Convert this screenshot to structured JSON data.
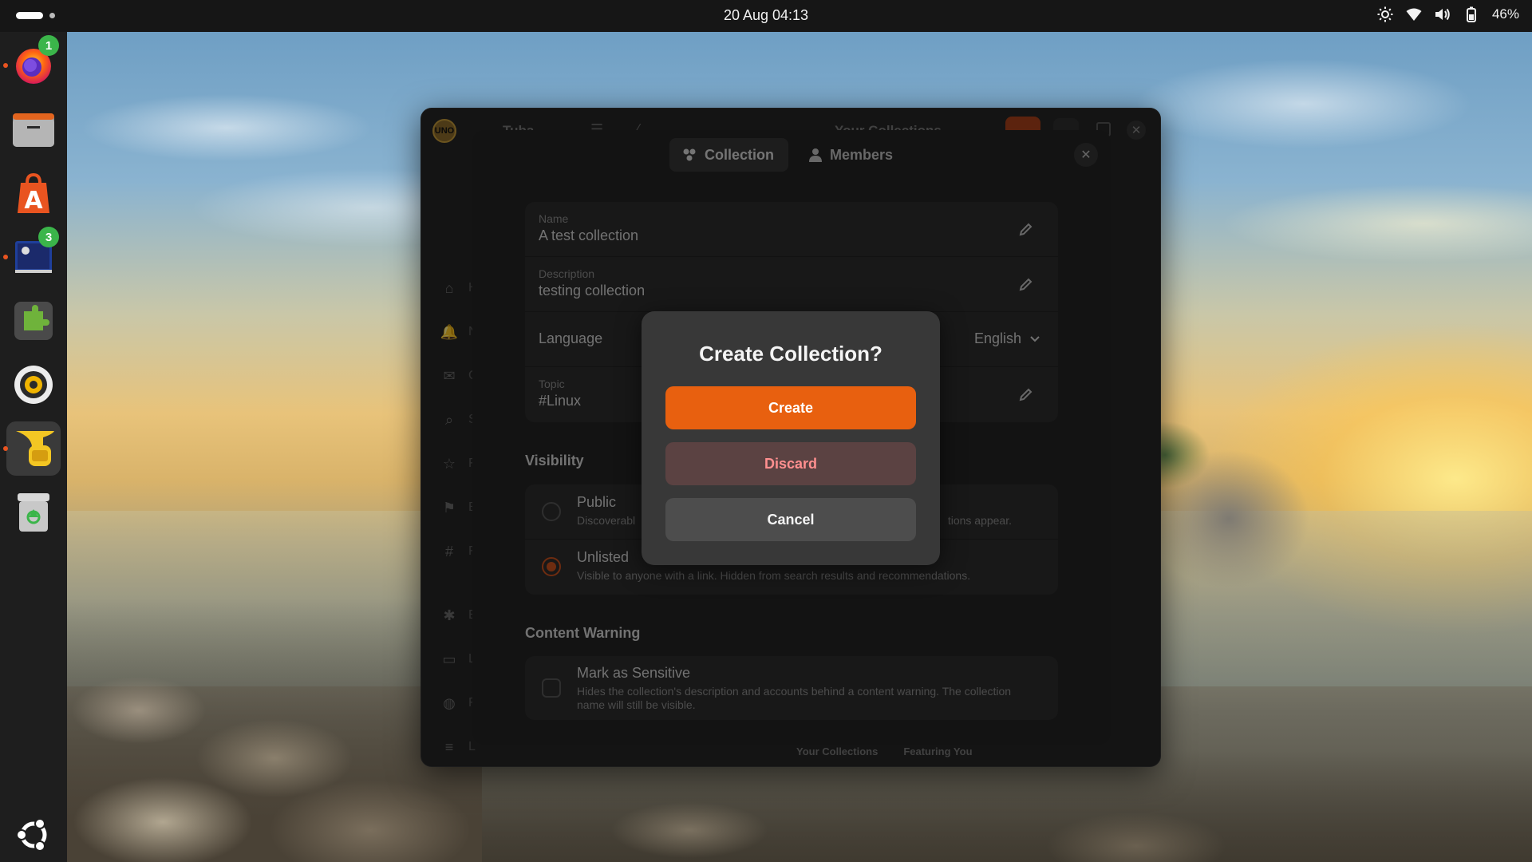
{
  "topbar": {
    "clock": "20 Aug  04:13",
    "battery": "46%",
    "icons": [
      "brightness-icon",
      "wifi-icon",
      "volume-icon",
      "battery-icon"
    ]
  },
  "dock": {
    "items": [
      {
        "name": "firefox",
        "badge": "1",
        "running": true
      },
      {
        "name": "files",
        "running": false
      },
      {
        "name": "app-center",
        "running": false
      },
      {
        "name": "terminal-app",
        "badge": "3",
        "running": true
      },
      {
        "name": "extensions",
        "running": false
      },
      {
        "name": "rhythmbox",
        "running": false
      },
      {
        "name": "tuba",
        "running": true,
        "active": true
      },
      {
        "name": "trash",
        "running": false
      }
    ],
    "show_apps_icon": "ubuntu-logo-icon"
  },
  "app": {
    "logo_text": "UNO",
    "title": "Tuba",
    "page_title": "Your Collections",
    "bottom_tabs": [
      "Your Collections",
      "Featuring You"
    ]
  },
  "sheet": {
    "tabs": [
      {
        "label": "Collection",
        "icon": "collection-icon",
        "selected": true
      },
      {
        "label": "Members",
        "icon": "person-icon",
        "selected": false
      }
    ],
    "name_caption": "Name",
    "name_value": "A test collection",
    "description_caption": "Description",
    "description_value": "testing collection",
    "language_label": "Language",
    "language_value": "English",
    "topic_caption": "Topic",
    "topic_value": "#Linux",
    "visibility_title": "Visibility",
    "public_title": "Public",
    "public_sub_left": "Discoverabl",
    "public_sub_right": "tions appear.",
    "unlisted_title": "Unlisted",
    "unlisted_sub": "Visible to anyone with a link. Hidden from search results and recommendations.",
    "content_warning_title": "Content Warning",
    "sensitive_title": "Mark as Sensitive",
    "sensitive_sub": "Hides the collection's description and accounts behind a content warning. The collection name will still be visible."
  },
  "dialog": {
    "title": "Create Collection?",
    "create_label": "Create",
    "discard_label": "Discard",
    "cancel_label": "Cancel"
  },
  "colors": {
    "accent": "#e8600f",
    "destructive_text": "#ff8f8f",
    "dock_badge": "#3bb54a"
  }
}
